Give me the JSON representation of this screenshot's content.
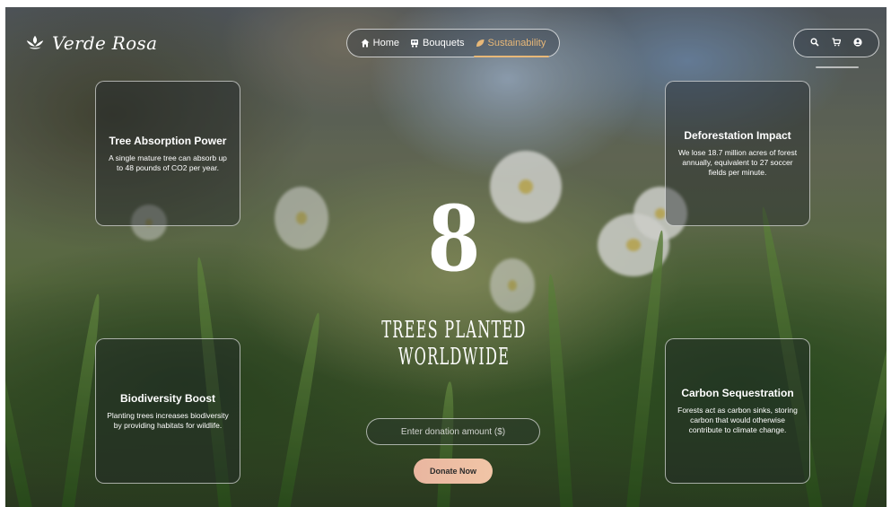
{
  "brand": {
    "name": "Verde Rosa"
  },
  "nav": {
    "items": [
      {
        "label": "Home",
        "icon": "home-icon",
        "active": false
      },
      {
        "label": "Bouquets",
        "icon": "bouquet-icon",
        "active": false
      },
      {
        "label": "Sustainability",
        "icon": "leaf-icon",
        "active": true
      }
    ]
  },
  "toolbar": {
    "icons": [
      "search-icon",
      "cart-icon",
      "user-icon"
    ]
  },
  "cards": [
    {
      "title": "Tree Absorption Power",
      "text": "A single mature tree can absorb up to 48 pounds of CO2 per year."
    },
    {
      "title": "Deforestation Impact",
      "text": "We lose 18.7 million acres of forest annually, equivalent to 27 soccer fields per minute."
    },
    {
      "title": "Biodiversity Boost",
      "text": "Planting trees increases biodiversity by providing habitats for wildlife."
    },
    {
      "title": "Carbon Sequestration",
      "text": "Forests act as carbon sinks, storing carbon that would otherwise contribute to climate change."
    }
  ],
  "counter": {
    "value": "8",
    "label": "TREES PLANTED WORLDWIDE"
  },
  "donation": {
    "placeholder": "Enter donation amount ($)",
    "button_label": "Donate Now"
  },
  "colors": {
    "accent": "#e8b878",
    "button": "#f1c5a6"
  }
}
